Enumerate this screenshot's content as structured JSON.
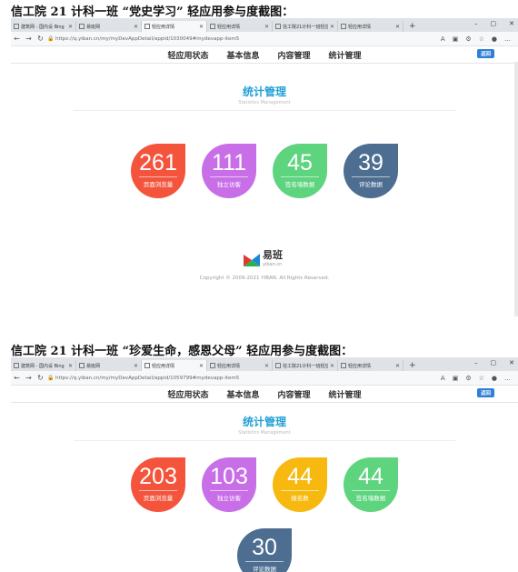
{
  "captions": [
    "信工院 21 计科一班 “党史学习” 轻应用参与度截图：",
    "信工院 21 计科一班 “珍爱生命，感恩父母” 轻应用参与度截图："
  ],
  "shots": [
    {
      "tabs": [
        "建筑网 - 国内设 Bing",
        "易班网",
        "轻应用详情",
        "轻应用详情",
        "信工院21计科一班轻应",
        "轻应用详情"
      ],
      "active_tab": 2,
      "url": "https://q.yiban.cn/my/myDevAppDetail/appid/1030049#mydevapp-item5",
      "menu": [
        "轻应用状态",
        "基本信息",
        "内容管理",
        "统计管理"
      ],
      "back_label": "返回",
      "section_title": "统计管理",
      "section_subtitle": "Statistics Management",
      "stats": [
        {
          "value": "261",
          "label": "页面浏览量",
          "color": "#f4543c"
        },
        {
          "value": "111",
          "label": "独立访客",
          "color": "#c86fe8"
        },
        {
          "value": "45",
          "label": "签名墙数据",
          "color": "#5ed47f"
        },
        {
          "value": "39",
          "label": "评论数据",
          "color": "#4d6e91"
        }
      ],
      "logo_text": "易班",
      "logo_url": "yiban.cn",
      "copyright": "Copyright © 2009-2021 YIBAN. All Rights Reserved."
    },
    {
      "tabs": [
        "建筑网 - 国内设 Bing",
        "易班网",
        "轻应用详情",
        "轻应用详情",
        "信工院21计科一班轻应",
        "轻应用详情"
      ],
      "active_tab": 2,
      "url": "https://q.yiban.cn/my/myDevAppDetail/appid/1059799#mydevapp-item5",
      "menu": [
        "轻应用状态",
        "基本信息",
        "内容管理",
        "统计管理"
      ],
      "back_label": "返回",
      "section_title": "统计管理",
      "section_subtitle": "Statistics Management",
      "stats": [
        {
          "value": "203",
          "label": "页面浏览量",
          "color": "#f4543c"
        },
        {
          "value": "103",
          "label": "独立访客",
          "color": "#c86fe8"
        },
        {
          "value": "44",
          "label": "报名数",
          "color": "#f7b90f"
        },
        {
          "value": "44",
          "label": "签名墙数据",
          "color": "#5ed47f"
        },
        {
          "value": "30",
          "label": "评论数据",
          "color": "#4d6e91"
        }
      ]
    }
  ],
  "icons": {
    "back": "←",
    "forward": "→",
    "refresh": "↻",
    "lock": "🔒",
    "new_tab": "+",
    "minimize": "–",
    "maximize": "▢",
    "close": "✕",
    "favorite": "☆"
  }
}
